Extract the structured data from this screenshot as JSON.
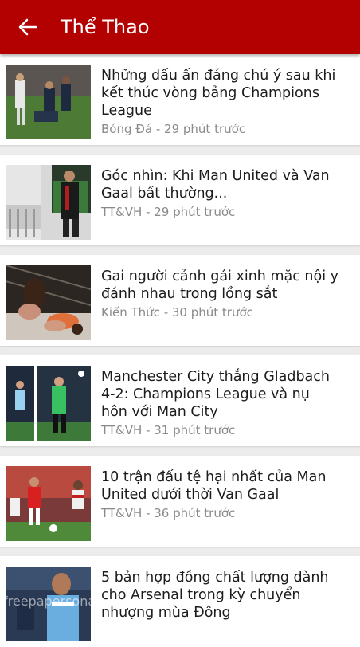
{
  "header": {
    "title": "Thể Thao",
    "back_icon": "arrow-left-icon",
    "bg_color": "#b30000"
  },
  "articles": [
    {
      "title": "Những dấu ấn đáng chú ý sau khi kết thúc vòng bảng Champions League",
      "source": "Bóng Đá",
      "time": "29 phút trước"
    },
    {
      "title": "Góc nhìn: Khi Man United và Van Gaal bất thường...",
      "source": "TT&VH",
      "time": "29 phút trước"
    },
    {
      "title": "Gai người cảnh gái xinh mặc nội y đánh nhau trong lồng sắt",
      "source": "Kiến Thức",
      "time": "30 phút trước"
    },
    {
      "title": "Manchester City thắng Gladbach 4-2: Champions League và nụ hôn với Man City",
      "source": "TT&VH",
      "time": "31 phút trước"
    },
    {
      "title": "10 trận đấu tệ hại nhất của Man United dưới thời Van Gaal",
      "source": "TT&VH",
      "time": "36 phút trước"
    },
    {
      "title": "5 bản hợp đồng chất lượng dành cho Arsenal trong kỳ chuyển nhượng mùa Đông",
      "source": "",
      "time": ""
    }
  ],
  "meta_separator": " - ",
  "watermark": "freepapersonal"
}
